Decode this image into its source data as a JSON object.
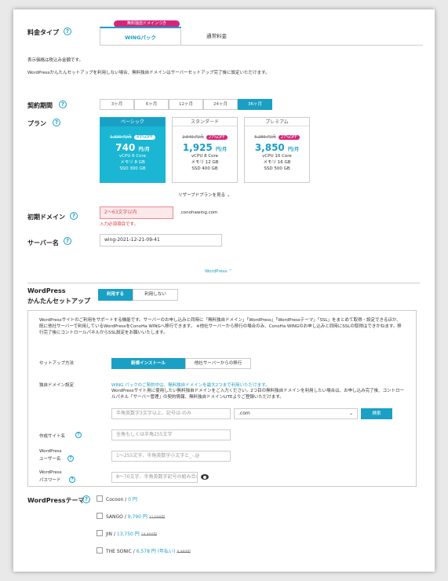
{
  "tabs": {
    "badge": "無料独自ドメインつき",
    "wing": "WINGパック",
    "normal": "通常料金"
  },
  "labels": {
    "fee_type": "料金タイプ",
    "period": "契約期間",
    "plan": "プラン",
    "domain": "初期ドメイン",
    "server_name": "サーバー名",
    "wp_setup_1": "WordPress",
    "wp_setup_2": "かんたんセットアップ",
    "setup_method": "セットアップ方法",
    "own_domain": "独自ドメイン設定",
    "site_name": "作成サイト名",
    "wp_user_1": "WordPress",
    "wp_user_2": "ユーザー名",
    "wp_pass_1": "WordPress",
    "wp_pass_2": "パスワード",
    "wp_theme": "WordPressテーマ"
  },
  "notes": {
    "tax": "表示価格は税込み金額です。",
    "wp_note": "WordPressかんたんセットアップを利用しない場合、無料独自ドメインはサーバーセットアップ完了後に設定いただけます。"
  },
  "periods": [
    "3ヶ月",
    "6ヶ月",
    "12ヶ月",
    "24ヶ月",
    "36ヶ月"
  ],
  "plans": [
    {
      "name": "ベーシック",
      "old": "1,320 円/月",
      "off": "43%OFF",
      "price": "740",
      "unit": "円/月",
      "cpu": "vCPU 6 Core",
      "mem": "メモリ 8 GB",
      "ssd": "SSD 300 GB"
    },
    {
      "name": "スタンダード",
      "old": "2,640 円/月",
      "off": "27%OFF",
      "price": "1,925",
      "unit": "円/月",
      "cpu": "vCPU 8 Core",
      "mem": "メモリ 12 GB",
      "ssd": "SSD 400 GB"
    },
    {
      "name": "プレミアム",
      "old": "5,280 円/月",
      "off": "27%OFF",
      "price": "3,850",
      "unit": "円/月",
      "cpu": "vCPU 10 Core",
      "mem": "メモリ 16 GB",
      "ssd": "SSD 500 GB"
    }
  ],
  "more_plans": "リザーブドプランを見る",
  "domain": {
    "placeholder": "2～63文字以内",
    "suffix": ".conohawing.com",
    "error": "入力必須項目です。"
  },
  "server_name": "wing-2021-12-21-09-41",
  "wp_toggle": "WordPress",
  "wp_setup": {
    "use": "利用する",
    "nouse": "利用しない"
  },
  "info": "WordPressサイトのご利用をサポートする機能です。サーバーのお申し込みと同時に「無料独自ドメイン」「WordPress」「WordPressテーマ」「SSL」をまとめて取得・設定できるほか、既に他社サーバーで利用しているWordPressをConoHa WINGへ移行できます。 ※他社サーバーから移行の場合のみ、ConoHa WINGのお申し込みと同時にSSLの取得はできかねます。移行完了後にコントロールパネルからSSL設定をお願いいたします。",
  "setup_methods": {
    "new": "新規インストール",
    "migrate": "他社サーバーからの移行"
  },
  "domain_note_1": "WING パックのご契約中は、無料独自ドメインを最大2つまで利用いただけます。",
  "domain_note_2": "WordPressサイト用に使用したい無料独自ドメインをご入力ください。2つ目の無料独自ドメインを利用したい場合は、お申し込み完了後、コントロールパネル「サーバー管理」の契約情報、無料独自ドメインLITEよりご登録いただけます。",
  "domain_input_ph": "半角英数字3文字以上、記号は-のみ",
  "tld": ".com",
  "search_btn": "検索",
  "site_ph": "全角もしくは半角255文字",
  "user_ph": "1～255文字、半角英数字小文字と_-.@",
  "pass_ph": "8～70文字、半角英数字記号の組み合わせ",
  "themes": [
    {
      "name": "Cocoon",
      "price": "0 円",
      "old": ""
    },
    {
      "name": "SANGO",
      "price": "9,790 円",
      "old": "11,000円"
    },
    {
      "name": "JIN",
      "price": "13,750 円",
      "old": "14,800円"
    },
    {
      "name": "THE SONIC",
      "price": "6,578 円 (年払い)",
      "old": "8,980円"
    }
  ]
}
